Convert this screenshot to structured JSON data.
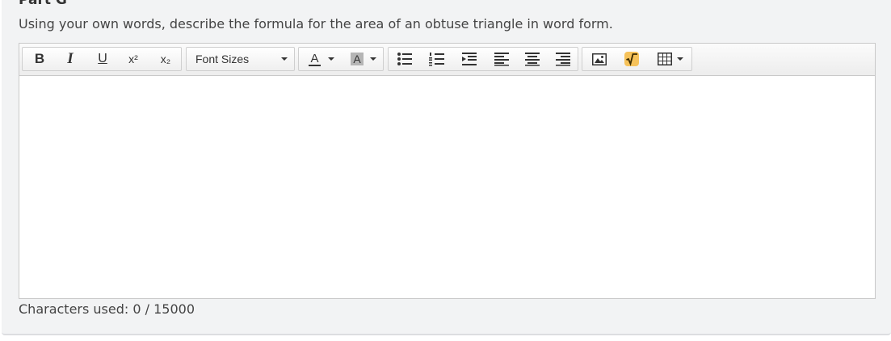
{
  "part_title": "Part G",
  "prompt": "Using your own words, describe the formula for the area of an obtuse triangle in word form.",
  "toolbar": {
    "bold": "B",
    "italic": "I",
    "underline": "U",
    "superscript": "x²",
    "subscript": "x₂",
    "font_sizes": "Font Sizes",
    "text_color": "A",
    "background_color": "A",
    "icons": {
      "bullet_list": "bullet-list-icon",
      "numbered_list": "numbered-list-icon",
      "indent": "indent-icon",
      "align_left": "align-left-icon",
      "align_center": "align-center-icon",
      "align_right": "align-right-icon",
      "image": "image-icon",
      "math": "math-equation-icon",
      "table": "table-icon"
    }
  },
  "editor": {
    "content": ""
  },
  "characters": "Characters used: 0 / 15000"
}
